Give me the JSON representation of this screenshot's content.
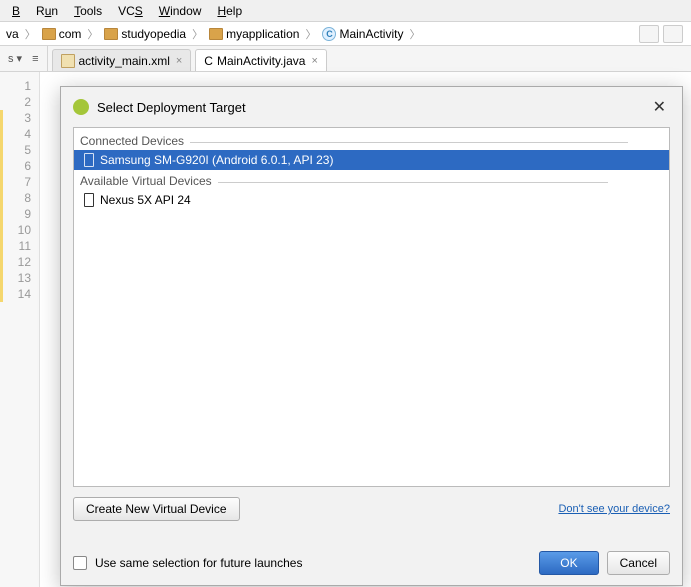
{
  "menu": {
    "items": [
      "Build",
      "Run",
      "Tools",
      "VCS",
      "Window",
      "Help"
    ]
  },
  "breadcrumb": {
    "items": [
      {
        "label": "va",
        "type": "text"
      },
      {
        "label": "com",
        "type": "folder"
      },
      {
        "label": "studyopedia",
        "type": "folder"
      },
      {
        "label": "myapplication",
        "type": "folder"
      },
      {
        "label": "MainActivity",
        "type": "class"
      }
    ]
  },
  "toolbar_left": {
    "label": "s ▾",
    "extra": "≡"
  },
  "tabs": [
    {
      "label": "activity_main.xml",
      "active": false,
      "icon": "xml"
    },
    {
      "label": "MainActivity.java",
      "active": true,
      "icon": "class"
    }
  ],
  "gutter_lines": [
    "1",
    "2",
    "3",
    "4",
    "5",
    "6",
    "7",
    "8",
    "9",
    "10",
    "11",
    "12",
    "13",
    "14"
  ],
  "dialog": {
    "title": "Select Deployment Target",
    "groups": [
      {
        "label": "Connected Devices",
        "devices": [
          {
            "name": "Samsung SM-G920I (Android 6.0.1, API 23)",
            "selected": true
          }
        ]
      },
      {
        "label": "Available Virtual Devices",
        "devices": [
          {
            "name": "Nexus 5X API 24",
            "selected": false
          }
        ]
      }
    ],
    "create_btn": "Create New Virtual Device",
    "help_link": "Don't see your device?",
    "checkbox_label": "Use same selection for future launches",
    "ok_btn": "OK",
    "cancel_btn": "Cancel"
  }
}
